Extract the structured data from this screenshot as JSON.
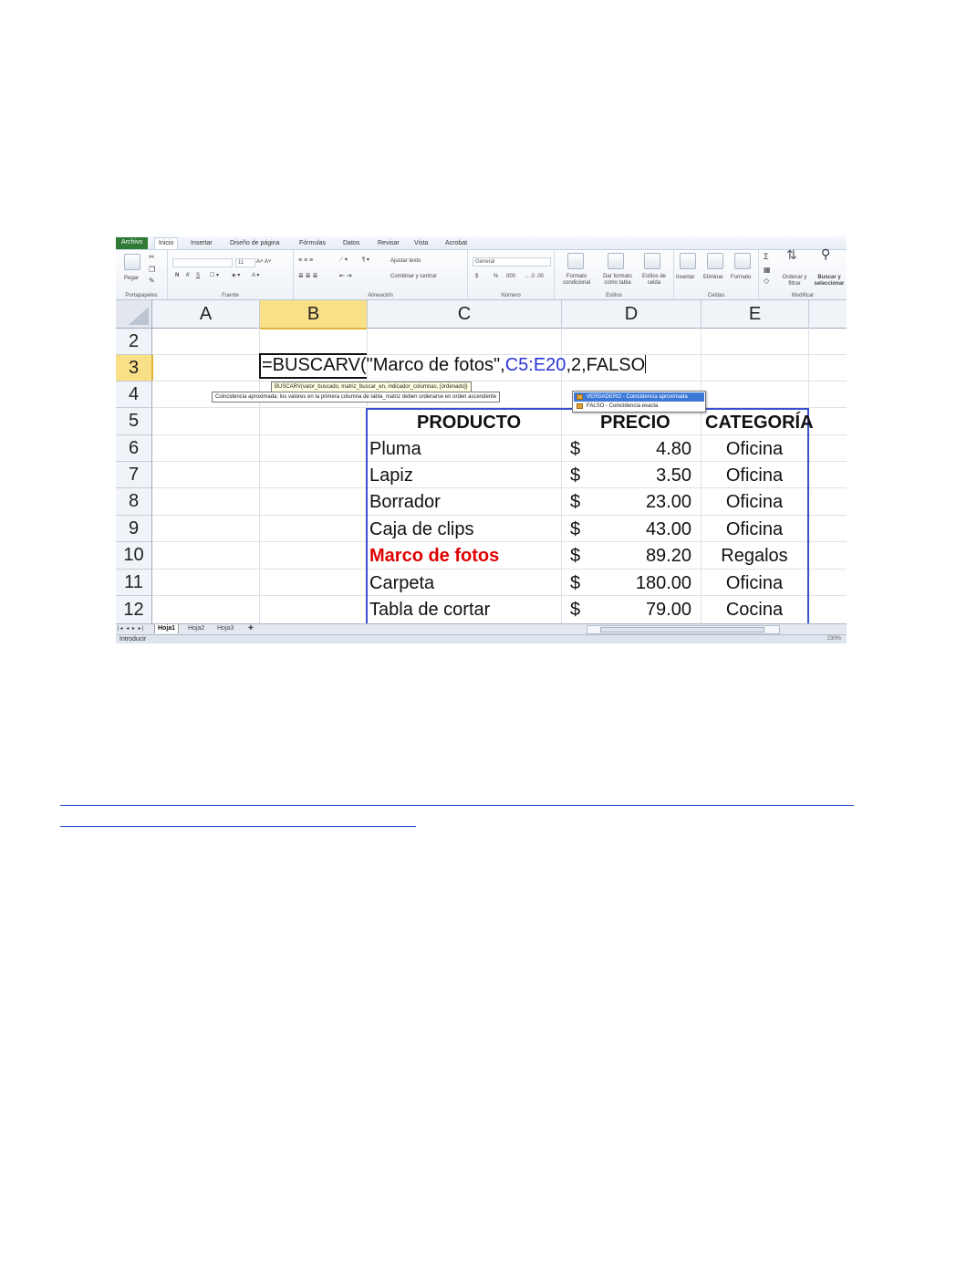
{
  "ribbon": {
    "tabs": [
      "Archivo",
      "Inicio",
      "Insertar",
      "Diseño de página",
      "Fórmulas",
      "Datos",
      "Revisar",
      "Vista",
      "Acrobat"
    ],
    "active_tab": "Inicio",
    "groups": {
      "portapapeles": "Portapapeles",
      "fuente": "Fuente",
      "alineacion": "Alineación",
      "numero": "Número",
      "estilos": "Estilos",
      "celdas": "Celdas",
      "modificar": "Modificar"
    },
    "pegar": "Pegar",
    "font_size": "11",
    "bold": "N",
    "italic": "K",
    "underline": "S",
    "ajustar_texto": "Ajustar texto",
    "combinar": "Combinar y centrar",
    "number_format": "General",
    "currency": "$",
    "percent": "%",
    "thousands": "000",
    "formato_condicional": "Formato condicional",
    "dar_formato": "Dar formato como tabla",
    "estilos_celda": "Estilos de celda",
    "insertar": "Insertar",
    "eliminar": "Eliminar",
    "formato": "Formato",
    "ordenar": "Ordenar y filtrar",
    "buscar": "Buscar y seleccionar",
    "sigma": "Σ"
  },
  "grid": {
    "columns": [
      "A",
      "B",
      "C",
      "D",
      "E"
    ],
    "selected_column": "B",
    "rows": [
      "2",
      "3",
      "4",
      "5",
      "6",
      "7",
      "8",
      "9",
      "10",
      "11",
      "12"
    ],
    "selected_row": "3"
  },
  "formula": {
    "part1": "=BUSCARV(\"Marco de fotos\",",
    "ref": "C5:E20",
    "part2": ",2,FALSO"
  },
  "tooltip": {
    "syntax": "BUSCARV(valor_buscado, matriz_buscar_en, indicador_columnas, [ordenado])",
    "description": "Coincidencia aproximada: los valores en la primera columna de tabla_matriz deben ordenarse en orden ascendente"
  },
  "autocomplete": [
    "VERDADERO - Coincidencia aproximada",
    "FALSO - Coincidencia exacta"
  ],
  "table": {
    "headers": [
      "PRODUCTO",
      "PRECIO",
      "CATEGORÍA"
    ],
    "rows": [
      {
        "producto": "Pluma",
        "moneda": "$",
        "precio": "4.80",
        "categoria": "Oficina"
      },
      {
        "producto": "Lapiz",
        "moneda": "$",
        "precio": "3.50",
        "categoria": "Oficina"
      },
      {
        "producto": "Borrador",
        "moneda": "$",
        "precio": "23.00",
        "categoria": "Oficina"
      },
      {
        "producto": "Caja de clips",
        "moneda": "$",
        "precio": "43.00",
        "categoria": "Oficina"
      },
      {
        "producto": "Marco de fotos",
        "moneda": "$",
        "precio": "89.20",
        "categoria": "Regalos"
      },
      {
        "producto": "Carpeta",
        "moneda": "$",
        "precio": "180.00",
        "categoria": "Oficina"
      },
      {
        "producto": "Tabla de cortar",
        "moneda": "$",
        "precio": "79.00",
        "categoria": "Cocina"
      }
    ]
  },
  "sheets": [
    "Hoja1",
    "Hoja2",
    "Hoja3"
  ],
  "active_sheet": "Hoja1",
  "status": "Introducir",
  "zoom": "230%",
  "colors": {
    "file_tab": "#2f7a34",
    "selection_header": "#f9df86",
    "formula_ref": "#2a34d6",
    "table_border": "#3a4fd0",
    "highlight_text": "#e00000",
    "link_underline": "#2a4fd0"
  }
}
